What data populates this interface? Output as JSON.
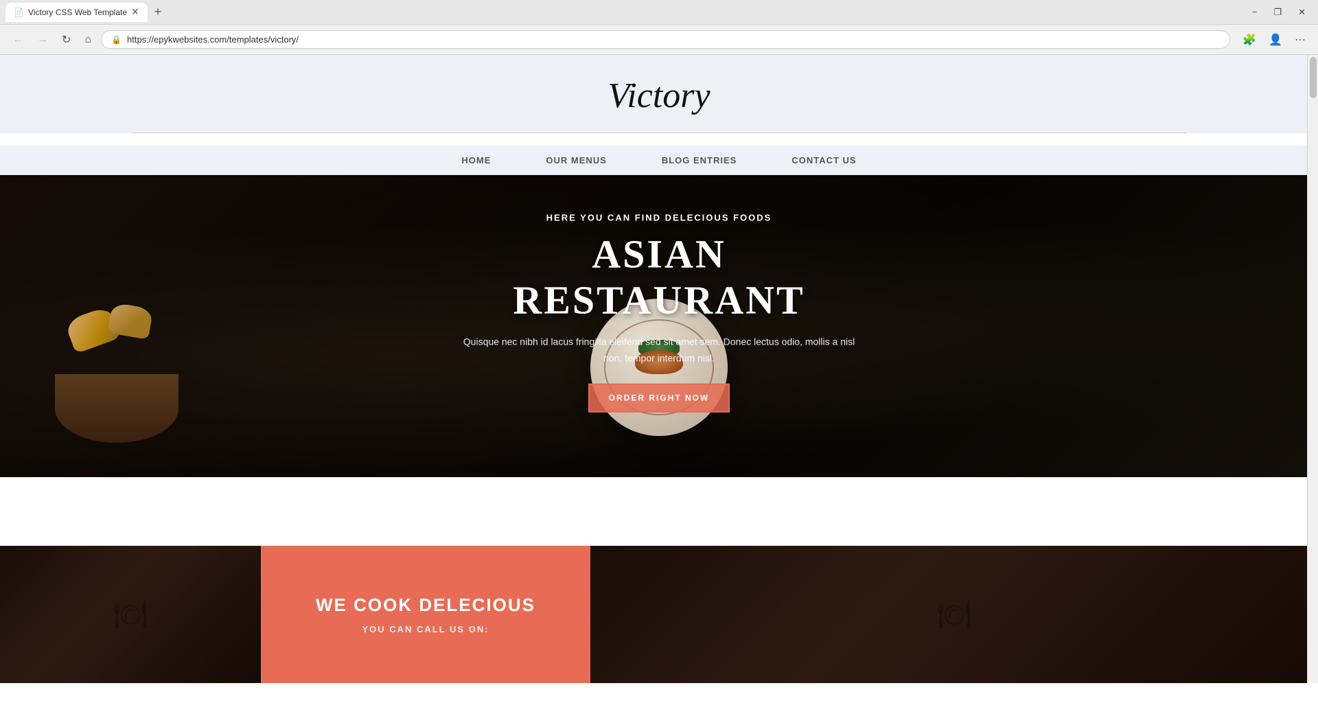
{
  "browser": {
    "tab_title": "Victory CSS Web Template",
    "tab_icon": "📄",
    "url": "https://epykwebsites.com/templates/victory/",
    "new_tab_label": "+",
    "controls": {
      "minimize": "−",
      "restore": "❐",
      "close": "✕"
    },
    "nav": {
      "back": "←",
      "forward": "→",
      "refresh": "↻",
      "home": "⌂"
    }
  },
  "site": {
    "title": "Victory",
    "nav_items": [
      {
        "id": "home",
        "label": "HOME"
      },
      {
        "id": "our-menus",
        "label": "OUR MENUS"
      },
      {
        "id": "blog-entries",
        "label": "BLOG ENTRIES"
      },
      {
        "id": "contact-us",
        "label": "CONTACT US"
      }
    ]
  },
  "hero": {
    "subtitle": "HERE YOU CAN FIND DELECIOUS FOODS",
    "title": "ASIAN RESTAURANT",
    "description": "Quisque nec nibh id lacus fringilla eleifend sed sit amet sem. Donec lectus odio, mollis a nisl non, tempor interdum nisl.",
    "cta_label": "ORDER RIGHT NOW"
  },
  "bottom_section": {
    "card_title": "WE COOK DELECIOUS",
    "card_subtitle": "YOU CAN CALL US ON:"
  }
}
